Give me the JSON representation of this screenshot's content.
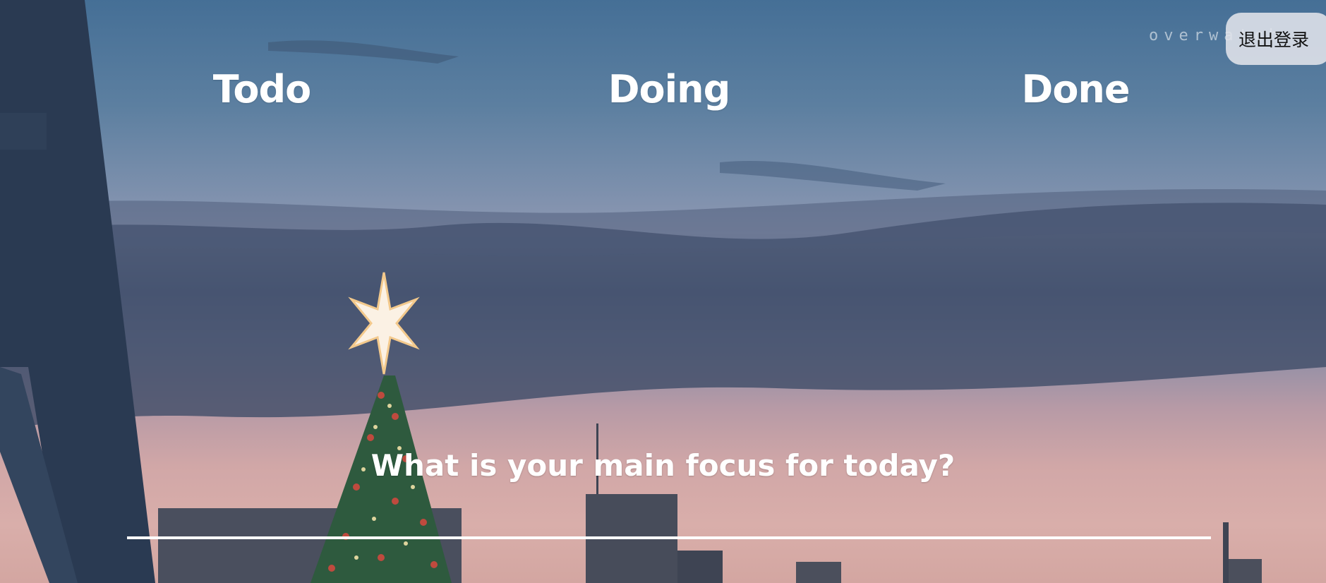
{
  "columns": {
    "todo": "Todo",
    "doing": "Doing",
    "done": "Done"
  },
  "header": {
    "logout_label": "退出登录",
    "watermark": "overwatch"
  },
  "focus": {
    "question": "What is your main focus for today?",
    "input_value": "",
    "input_placeholder": ""
  },
  "colors": {
    "text": "#ffffff",
    "button_bg": "#e1e4ea",
    "button_text": "#111111"
  }
}
